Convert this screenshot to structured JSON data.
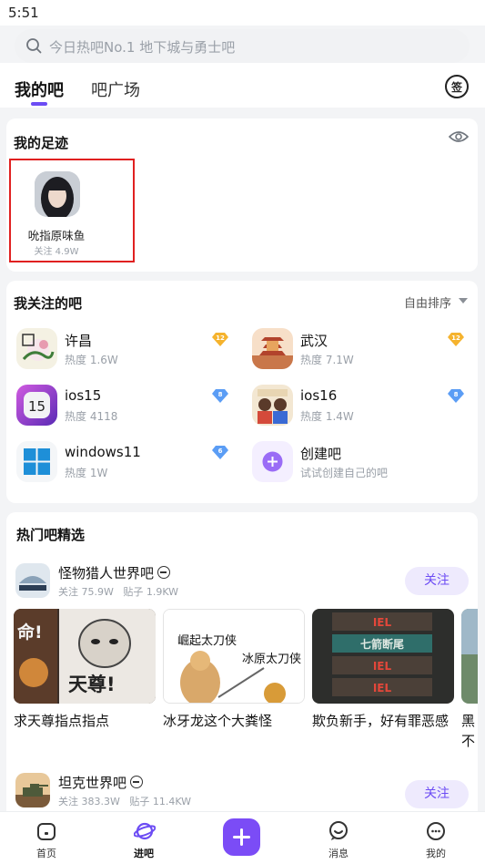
{
  "status": {
    "time": "5:51"
  },
  "search": {
    "placeholder": "今日热吧No.1 地下城与勇士吧"
  },
  "tabs": {
    "mine": "我的吧",
    "square": "吧广场"
  },
  "sign_label": "签",
  "footprints": {
    "title": "我的足迹",
    "items": [
      {
        "name": "吮指原味鱼",
        "followers": "关注 4.9W"
      }
    ]
  },
  "followed": {
    "title": "我关注的吧",
    "sort_label": "自由排序",
    "items": [
      {
        "name": "许昌",
        "heat": "热度 1.6W",
        "level": "12",
        "level_color": "#f5b32e",
        "icon": "xuchang-icon"
      },
      {
        "name": "武汉",
        "heat": "热度 7.1W",
        "level": "12",
        "level_color": "#f5b32e",
        "icon": "wuhan-icon"
      },
      {
        "name": "ios15",
        "heat": "热度 4118",
        "level": "8",
        "level_color": "#5b9df5",
        "icon": "ios15-icon"
      },
      {
        "name": "ios16",
        "heat": "热度 1.4W",
        "level": "8",
        "level_color": "#5b9df5",
        "icon": "ios16-icon"
      },
      {
        "name": "windows11",
        "heat": "热度 1W",
        "level": "6",
        "level_color": "#5b9df5",
        "icon": "windows11-icon"
      },
      {
        "name": "创建吧",
        "heat": "试试创建自己的吧",
        "icon": "create-bar-icon"
      }
    ]
  },
  "hot": {
    "title": "热门吧精选",
    "bars": [
      {
        "name": "怪物猎人世界吧",
        "followers": "关注 75.9W",
        "posts": "贴子 1.9KW",
        "follow_label": "关注",
        "threads": [
          {
            "caption": "求天尊指点指点",
            "image_text": [
              "命!",
              "天尊!"
            ]
          },
          {
            "caption": "冰牙龙这个大粪怪",
            "image_text": [
              "崛起太刀侠",
              "冰原太刀侠"
            ]
          },
          {
            "caption": "欺负新手，好有罪恶感",
            "image_text": [
              "IEL",
              "七箭断尾",
              "IEL",
              "IEL"
            ]
          },
          {
            "caption": "黑不"
          }
        ]
      },
      {
        "name": "坦克世界吧",
        "followers": "关注 383.3W",
        "posts": "贴子 11.4KW",
        "follow_label": "关注"
      }
    ]
  },
  "tabbar": {
    "home": "首页",
    "bars": "进吧",
    "messages": "消息",
    "me": "我的"
  },
  "colors": {
    "accent": "#6c4cf4",
    "highlight_border": "#e02020"
  }
}
